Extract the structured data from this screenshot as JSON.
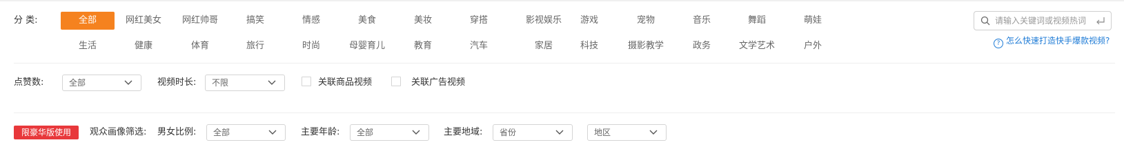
{
  "category": {
    "label": "分  类:",
    "row1": [
      "全部",
      "网红美女",
      "网红帅哥",
      "搞笑",
      "情感",
      "美食",
      "美妆",
      "穿搭",
      "影视娱乐",
      "游戏",
      "宠物",
      "音乐",
      "舞蹈",
      "萌娃"
    ],
    "row2": [
      "生活",
      "健康",
      "体育",
      "旅行",
      "时尚",
      "母婴育儿",
      "教育",
      "汽车",
      "家居",
      "科技",
      "摄影教学",
      "政务",
      "文学艺术",
      "户外"
    ],
    "active": "全部"
  },
  "search": {
    "placeholder": "请输入关键词或视频热词"
  },
  "help_link": "怎么快速打造快手爆款视频?",
  "filters": {
    "likes_label": "点赞数:",
    "likes_value": "全部",
    "duration_label": "视频时长:",
    "duration_value": "不限",
    "product_video_label": "关联商品视频",
    "ad_video_label": "关联广告视频"
  },
  "audience": {
    "badge": "限豪华版使用",
    "title": "观众画像筛选:",
    "gender_label": "男女比例:",
    "gender_value": "全部",
    "age_label": "主要年龄:",
    "age_value": "全部",
    "region_label": "主要地域:",
    "province_value": "省份",
    "area_value": "地区"
  },
  "colors": {
    "accent": "#f5821f",
    "badge": "#e8383b",
    "link": "#1e7bd6"
  }
}
